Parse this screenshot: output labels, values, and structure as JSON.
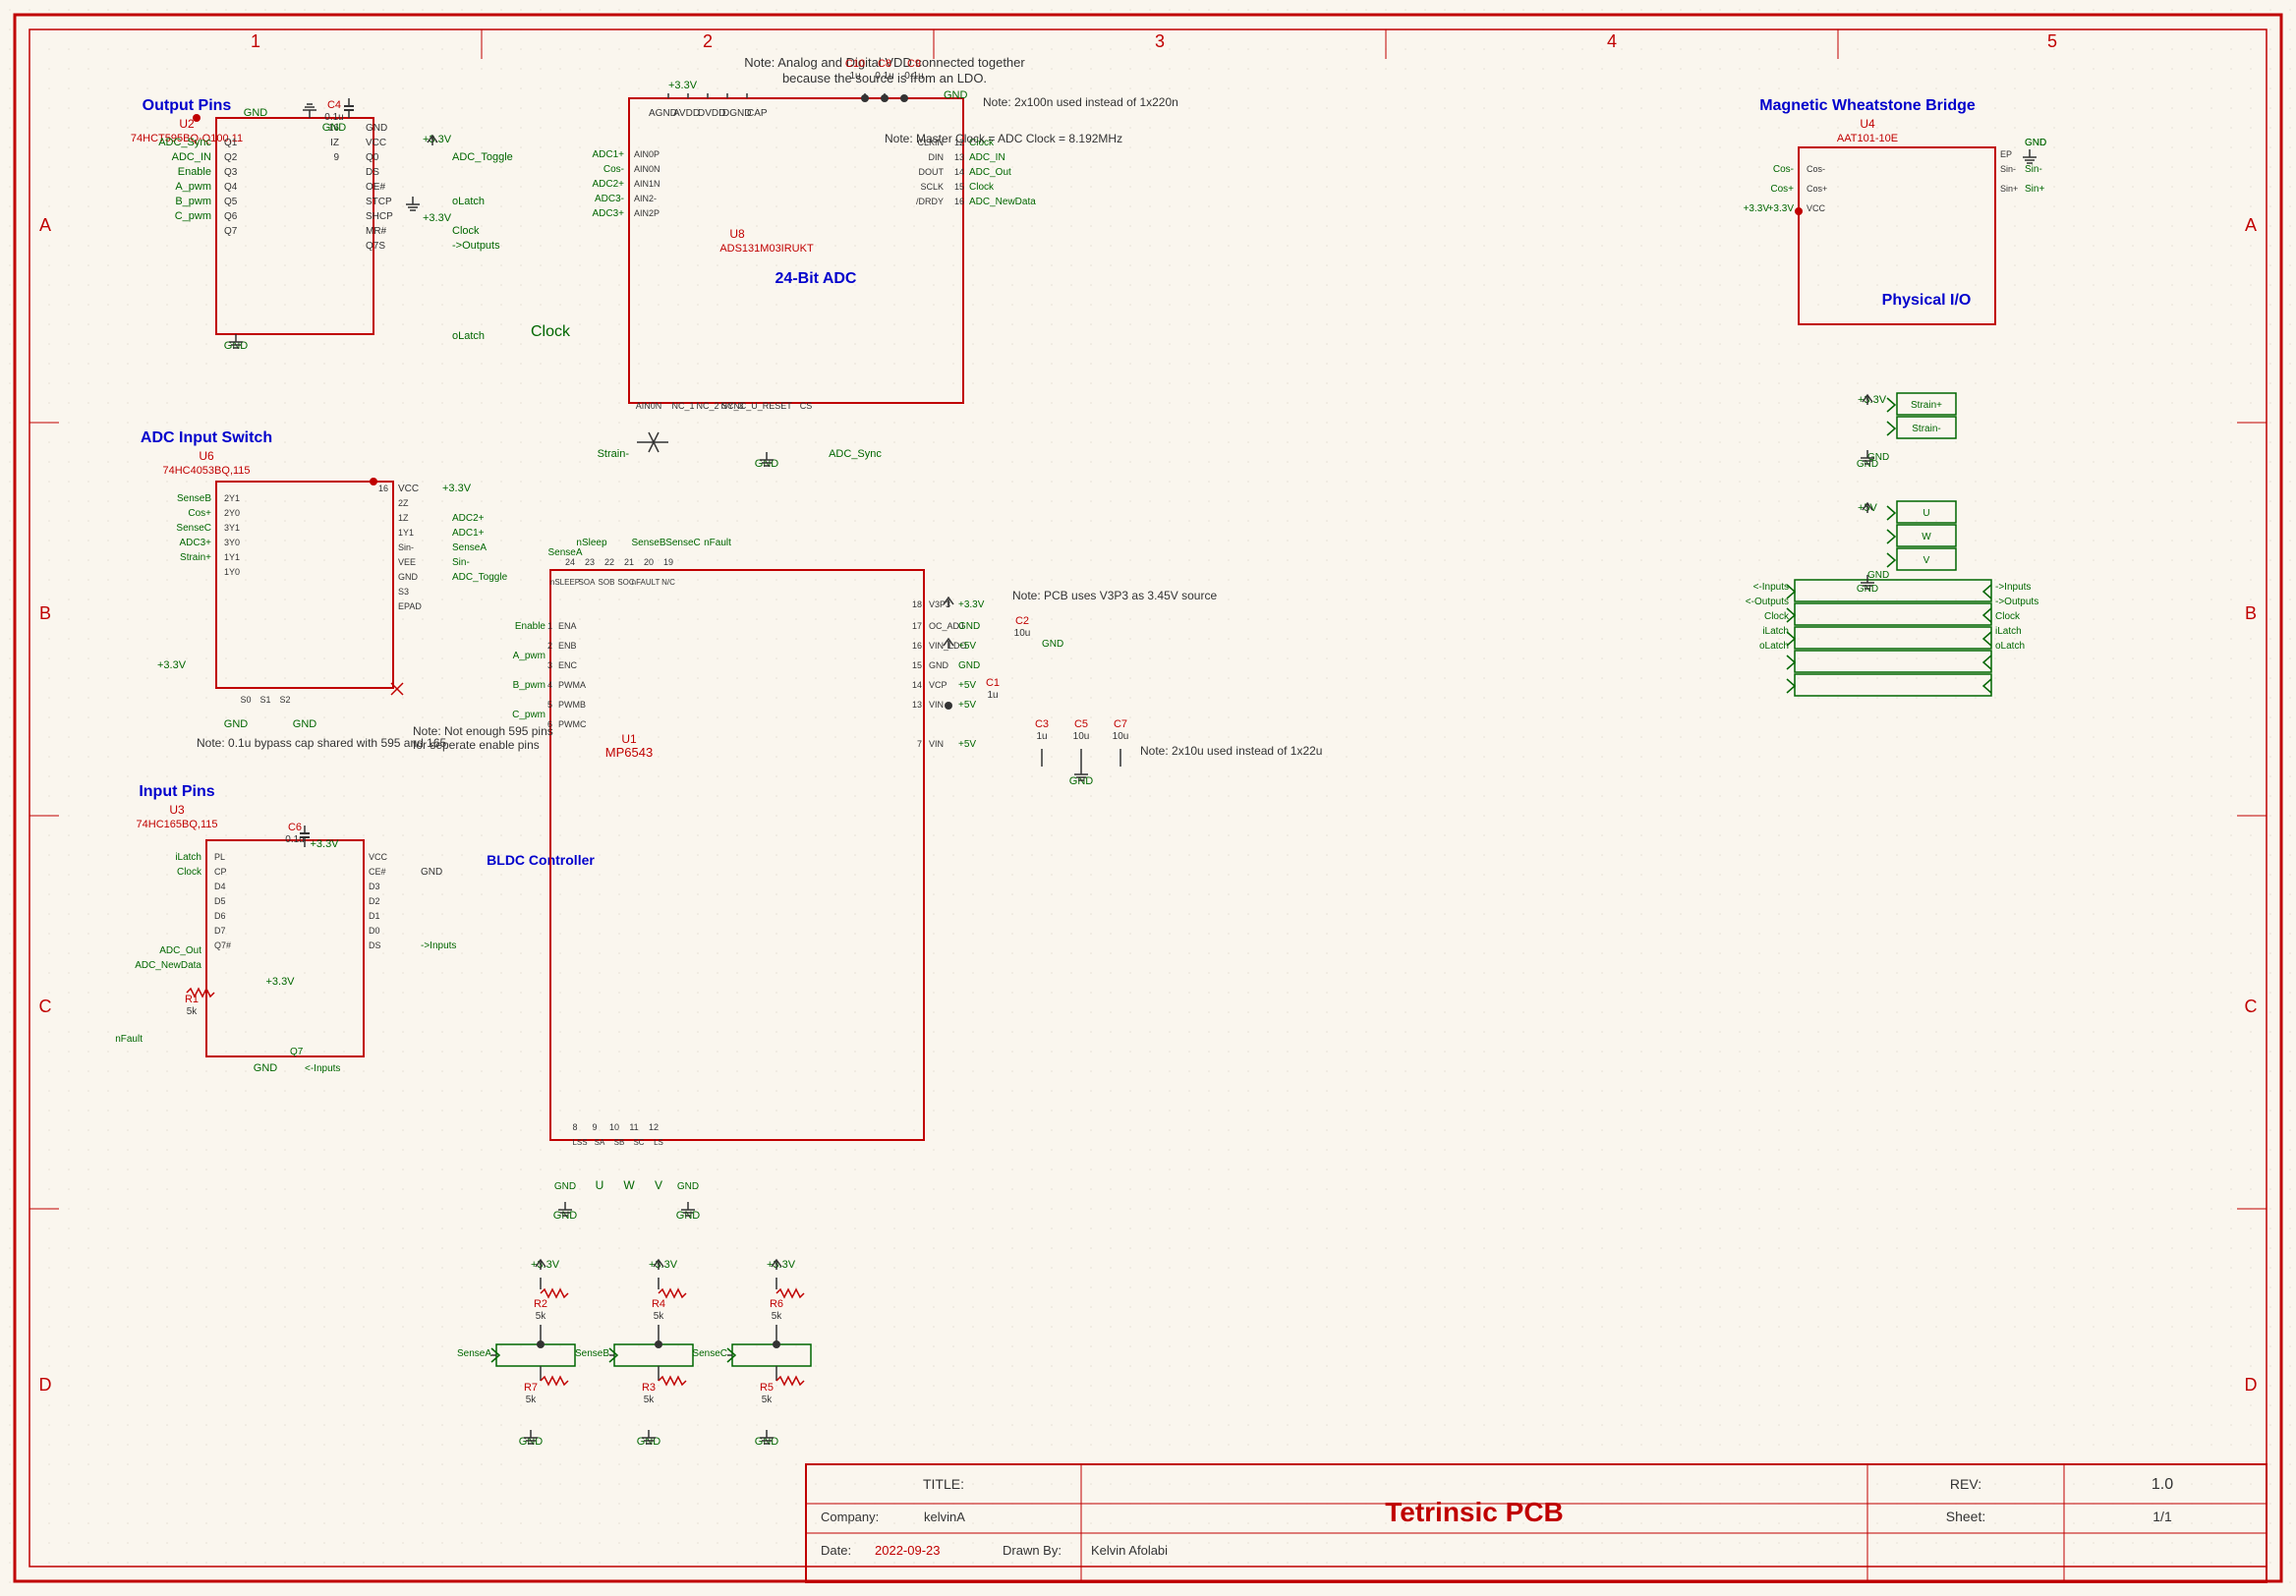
{
  "title": "Tetrinsic PCB",
  "revision": "1.0",
  "company": "kelvinA",
  "date": "2022-09-23",
  "drawn_by": "Kelvin Afolabi",
  "sheet": "1/1",
  "sections": {
    "output_pins": "Output Pins",
    "adc_input_switch": "ADC Input Switch",
    "input_pins": "Input Pins",
    "adc_24bit": "24-Bit ADC",
    "bldc_controller": "BLDC Controller",
    "magnetic_wheatstone": "Magnetic Wheatstone Bridge",
    "physical_io": "Physical I/O"
  },
  "components": {
    "U1": "MP6543",
    "U2": "74HCT595BQ-Q100,11",
    "U3": "74HC165BQ,115",
    "U4": "AAT101-10E",
    "U6": "74HC4053BQ,115",
    "U8": "ADS131M03IRUKT"
  },
  "notes": {
    "n1": "Note: Analog and Digital VDD connected together because the source is from an LDO.",
    "n2": "Note: 2x100n used instead of 1x220n",
    "n3": "Note: Master Clock = ADC Clock = 8.192MHz",
    "n4": "Note: PCB uses V3P3 as 3.45V source",
    "n5": "Note: 0.1u bypass cap shared with 595 and 165",
    "n6": "Note: Not enough 595 pins for seperate enable pins",
    "n7": "Note: 2x10u used instead of 1x22u"
  }
}
